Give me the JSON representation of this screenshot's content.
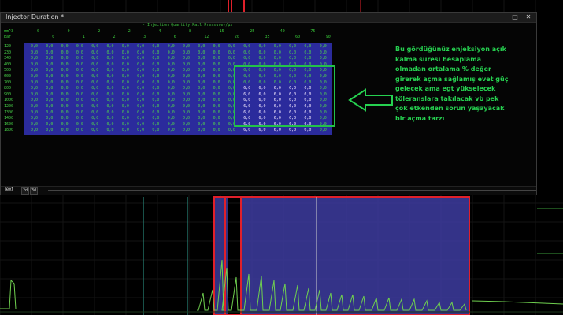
{
  "window": {
    "title": "Injector Duration *",
    "buttons": {
      "minimize": "−",
      "maximize": "□",
      "close": "✕"
    }
  },
  "table": {
    "axis_label": "-(Injection Quantity,Rail Pressure)/µs",
    "corner_top": "mm^3",
    "corner_bottom": "Bar",
    "col_headers_top": [
      "0",
      "0",
      "2",
      "2",
      "4",
      "8",
      "15",
      "25",
      "40",
      "75"
    ],
    "col_headers_bottom": [
      "0",
      "1",
      "2",
      "3",
      "6",
      "12",
      "20",
      "35",
      "60",
      "90"
    ],
    "row_labels": [
      "120",
      "230",
      "340",
      "400",
      "500",
      "600",
      "700",
      "800",
      "900",
      "1000",
      "1200",
      "1300",
      "1400",
      "1600",
      "1800"
    ],
    "cell_value": "0,0",
    "highlight_value": "6,0",
    "highlight_rows": [
      7,
      14
    ],
    "highlight_cols": [
      14,
      18
    ]
  },
  "annotation": {
    "lines": [
      "Bu gördüğünüz enjeksiyon açık",
      "kalma süresi hesaplama",
      "olmadan ortalama % değer",
      "girerek açma sağlamış evet güç",
      "gelecek ama egt yükselecek",
      "töleranslara takılacak vb pek",
      "çok etkenden sorun yaşayacak",
      "bir açma tarzı"
    ],
    "color": "#26d150"
  },
  "bottom_bar": {
    "mode_text": "Text",
    "btn_2d": "2d",
    "btn_3d": "3d"
  },
  "colors": {
    "grid_bg": "#2b2b9c",
    "highlight_box": "#22c14a",
    "overlay_red": "#e0202a"
  }
}
